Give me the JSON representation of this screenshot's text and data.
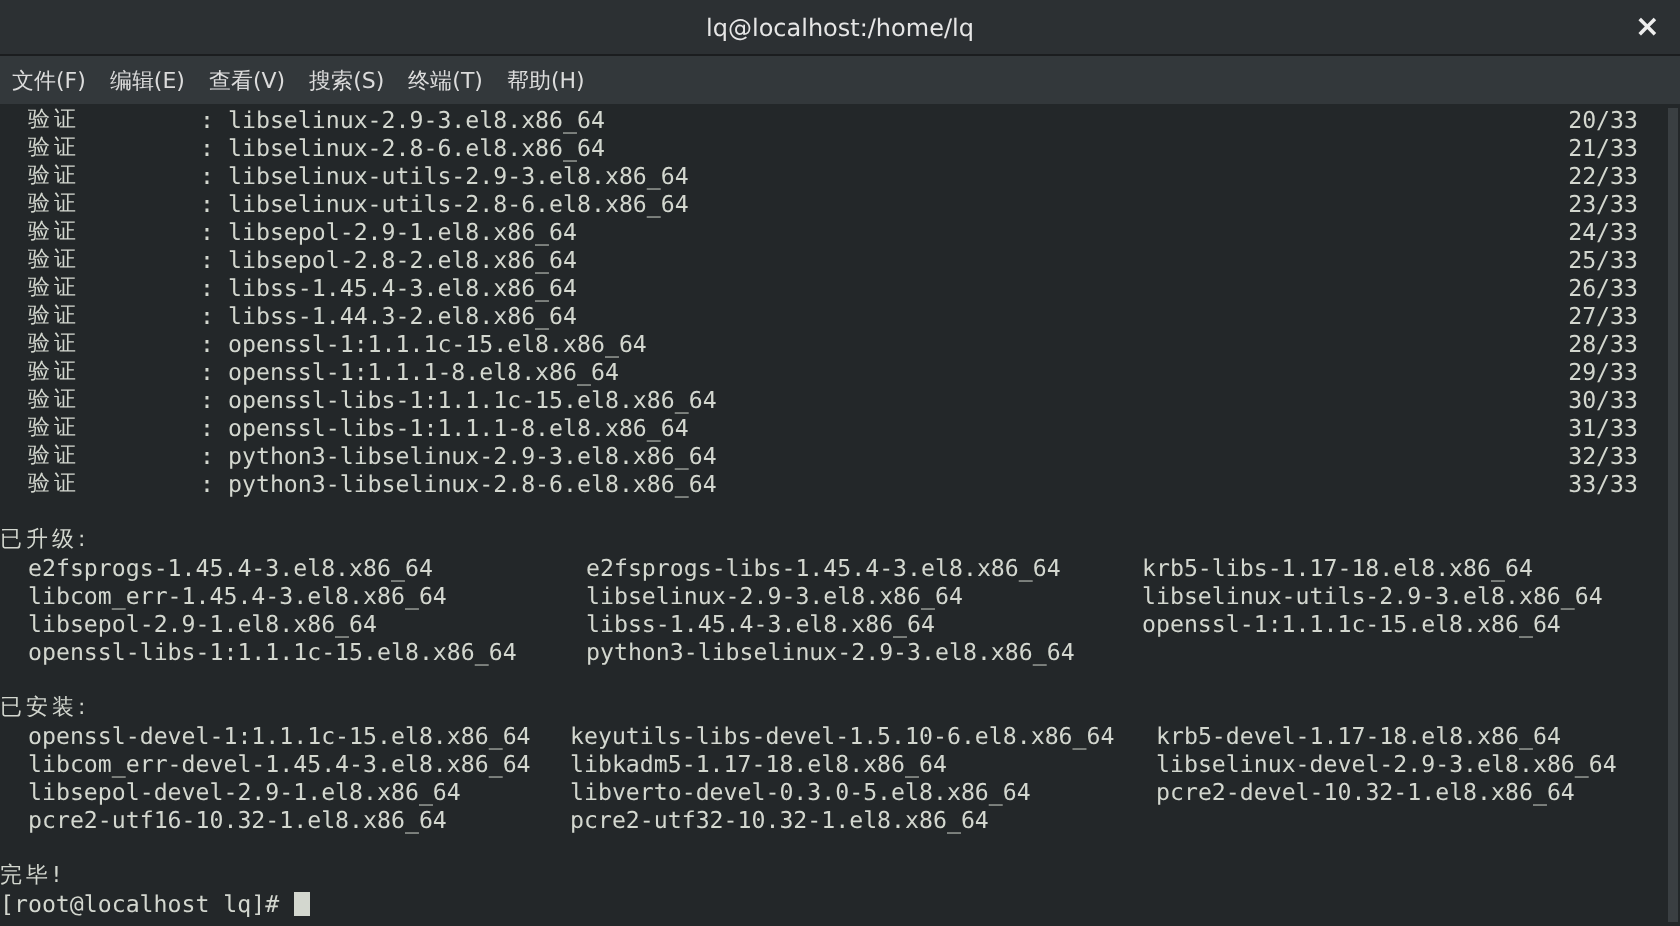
{
  "window": {
    "title": "lq@localhost:/home/lq",
    "close": "×"
  },
  "menu": [
    "文件(F)",
    "编辑(E)",
    "查看(V)",
    "搜索(S)",
    "终端(T)",
    "帮助(H)"
  ],
  "verify_rows": [
    {
      "label": "验证",
      "separator": ":",
      "package": "libselinux-2.9-3.el8.x86_64",
      "progress": "20/33"
    },
    {
      "label": "验证",
      "separator": ":",
      "package": "libselinux-2.8-6.el8.x86_64",
      "progress": "21/33"
    },
    {
      "label": "验证",
      "separator": ":",
      "package": "libselinux-utils-2.9-3.el8.x86_64",
      "progress": "22/33"
    },
    {
      "label": "验证",
      "separator": ":",
      "package": "libselinux-utils-2.8-6.el8.x86_64",
      "progress": "23/33"
    },
    {
      "label": "验证",
      "separator": ":",
      "package": "libsepol-2.9-1.el8.x86_64",
      "progress": "24/33"
    },
    {
      "label": "验证",
      "separator": ":",
      "package": "libsepol-2.8-2.el8.x86_64",
      "progress": "25/33"
    },
    {
      "label": "验证",
      "separator": ":",
      "package": "libss-1.45.4-3.el8.x86_64",
      "progress": "26/33"
    },
    {
      "label": "验证",
      "separator": ":",
      "package": "libss-1.44.3-2.el8.x86_64",
      "progress": "27/33"
    },
    {
      "label": "验证",
      "separator": ":",
      "package": "openssl-1:1.1.1c-15.el8.x86_64",
      "progress": "28/33"
    },
    {
      "label": "验证",
      "separator": ":",
      "package": "openssl-1:1.1.1-8.el8.x86_64",
      "progress": "29/33"
    },
    {
      "label": "验证",
      "separator": ":",
      "package": "openssl-libs-1:1.1.1c-15.el8.x86_64",
      "progress": "30/33"
    },
    {
      "label": "验证",
      "separator": ":",
      "package": "openssl-libs-1:1.1.1-8.el8.x86_64",
      "progress": "31/33"
    },
    {
      "label": "验证",
      "separator": ":",
      "package": "python3-libselinux-2.9-3.el8.x86_64",
      "progress": "32/33"
    },
    {
      "label": "验证",
      "separator": ":",
      "package": "python3-libselinux-2.8-6.el8.x86_64",
      "progress": "33/33"
    }
  ],
  "sections": [
    {
      "heading": "已升级:",
      "rows": [
        [
          "e2fsprogs-1.45.4-3.el8.x86_64",
          "e2fsprogs-libs-1.45.4-3.el8.x86_64",
          "krb5-libs-1.17-18.el8.x86_64"
        ],
        [
          "libcom_err-1.45.4-3.el8.x86_64",
          "libselinux-2.9-3.el8.x86_64",
          "libselinux-utils-2.9-3.el8.x86_64"
        ],
        [
          "libsepol-2.9-1.el8.x86_64",
          "libss-1.45.4-3.el8.x86_64",
          "openssl-1:1.1.1c-15.el8.x86_64"
        ],
        [
          "openssl-libs-1:1.1.1c-15.el8.x86_64",
          "python3-libselinux-2.9-3.el8.x86_64"
        ]
      ]
    },
    {
      "heading": "已安装:",
      "rows": [
        [
          "openssl-devel-1:1.1.1c-15.el8.x86_64",
          "keyutils-libs-devel-1.5.10-6.el8.x86_64",
          "krb5-devel-1.17-18.el8.x86_64"
        ],
        [
          "libcom_err-devel-1.45.4-3.el8.x86_64",
          "libkadm5-1.17-18.el8.x86_64",
          "libselinux-devel-2.9-3.el8.x86_64"
        ],
        [
          "libsepol-devel-2.9-1.el8.x86_64",
          "libverto-devel-0.3.0-5.el8.x86_64",
          "pcre2-devel-10.32-1.el8.x86_64"
        ],
        [
          "pcre2-utf16-10.32-1.el8.x86_64",
          "pcre2-utf32-10.32-1.el8.x86_64"
        ]
      ]
    }
  ],
  "done": "完毕!",
  "prompt": "[root@localhost lq]#"
}
